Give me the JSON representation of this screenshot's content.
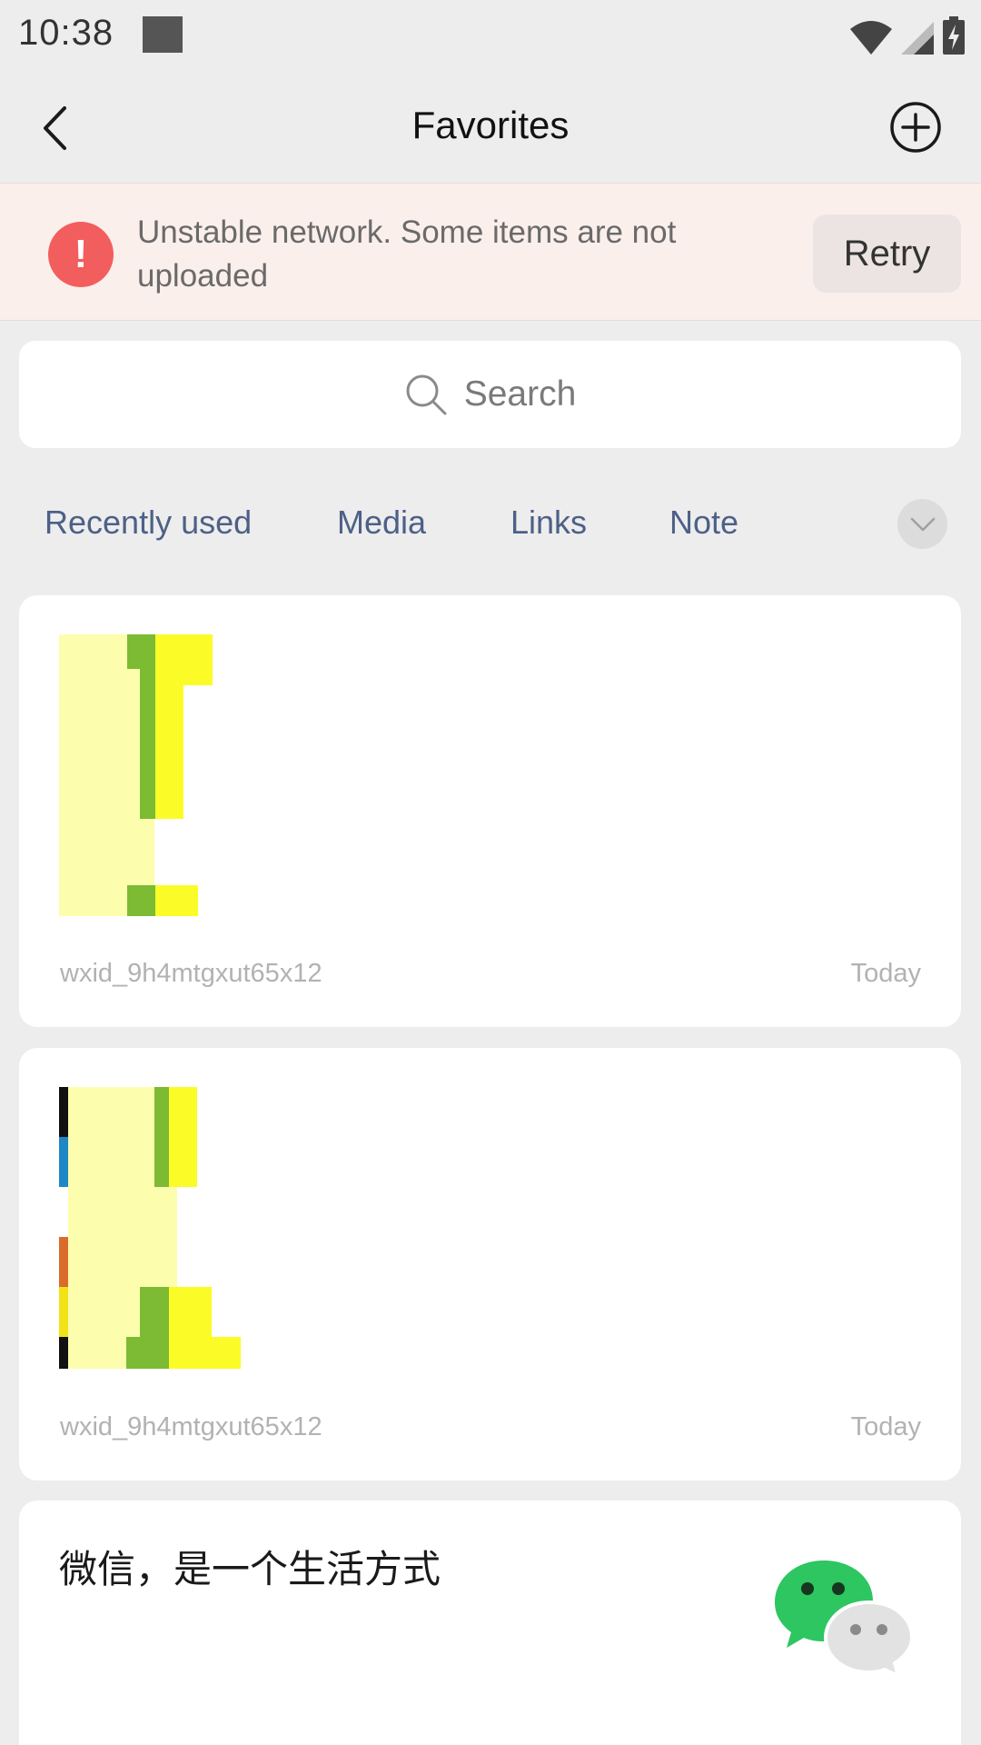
{
  "status_bar": {
    "time": "10:38"
  },
  "header": {
    "title": "Favorites"
  },
  "banner": {
    "message": "Unstable network. Some items are not uploaded",
    "icon_glyph": "!",
    "retry_label": "Retry"
  },
  "search": {
    "placeholder": "Search"
  },
  "filters": {
    "tabs": [
      {
        "label": "Recently used"
      },
      {
        "label": "Media"
      },
      {
        "label": "Links"
      },
      {
        "label": "Note"
      }
    ]
  },
  "favorites": [
    {
      "type": "image",
      "source": "wxid_9h4mtgxut65x12",
      "date": "Today"
    },
    {
      "type": "image",
      "source": "wxid_9h4mtgxut65x12",
      "date": "Today"
    },
    {
      "type": "note",
      "text": "微信，是一个生活方式"
    }
  ],
  "colors": {
    "accent_link": "#4d6087",
    "warning": "#f25d5d",
    "banner_bg": "#fbefec",
    "wechat_green": "#2dc661"
  }
}
